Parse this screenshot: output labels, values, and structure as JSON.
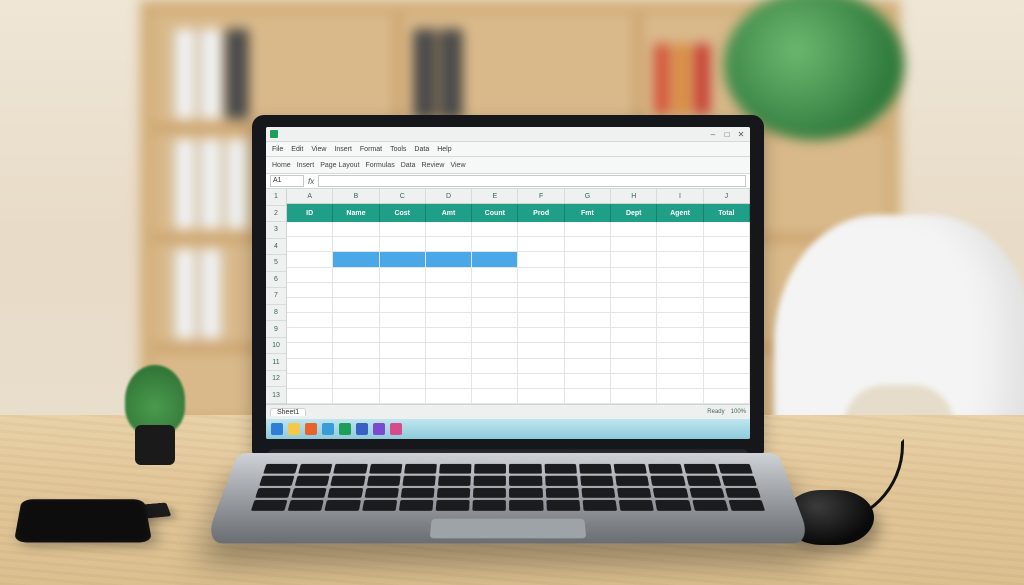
{
  "scene": {
    "description": "Photograph of a silver laptop on a light wooden desk in a home office. The laptop screen shows a spreadsheet application with a teal header row and a blue selected range. A black wired mouse, a black smartphone, a small potted plant, and a black notebook sit on the desk. Behind, blurred wooden bookshelves hold binders and books; a white office chair is to the right; a green houseplant is on the top shelf."
  },
  "app": {
    "window_controls": {
      "min": "–",
      "max": "□",
      "close": "✕"
    },
    "menus": [
      "File",
      "Edit",
      "View",
      "Insert",
      "Format",
      "Tools",
      "Data",
      "Help"
    ],
    "ribbon_tabs": [
      "Home",
      "Insert",
      "Page Layout",
      "Formulas",
      "Data",
      "Review",
      "View"
    ],
    "namebox": "A1",
    "fx_label": "fx",
    "column_letters": [
      "A",
      "B",
      "C",
      "D",
      "E",
      "F",
      "G",
      "H",
      "I",
      "J"
    ],
    "row_numbers": [
      "1",
      "2",
      "3",
      "4",
      "5",
      "6",
      "7",
      "8",
      "9",
      "10",
      "11",
      "12",
      "13"
    ],
    "table_headers": [
      "ID",
      "Name",
      "Cost",
      "Amt",
      "Count",
      "Prod",
      "Fmt",
      "Dept",
      "Agent",
      "Total"
    ],
    "sheet_tab": "Sheet1",
    "status_right": [
      "Ready",
      "100%"
    ],
    "selection": {
      "row": 3,
      "col_start": 1,
      "col_end": 4
    },
    "colors": {
      "header_bg": "#1f9e88",
      "selection_bg": "#4aa8e8",
      "taskbar": "#8fcadc"
    }
  },
  "taskbar_icons": [
    {
      "name": "start",
      "color": "#2e7dd7"
    },
    {
      "name": "explorer",
      "color": "#f4c94b"
    },
    {
      "name": "browser",
      "color": "#e8622c"
    },
    {
      "name": "mail",
      "color": "#3a9bd9"
    },
    {
      "name": "spreadsheet",
      "color": "#1f9e5a"
    },
    {
      "name": "docs",
      "color": "#3960c4"
    },
    {
      "name": "store",
      "color": "#7a4bcc"
    },
    {
      "name": "media",
      "color": "#d94a8a"
    }
  ]
}
